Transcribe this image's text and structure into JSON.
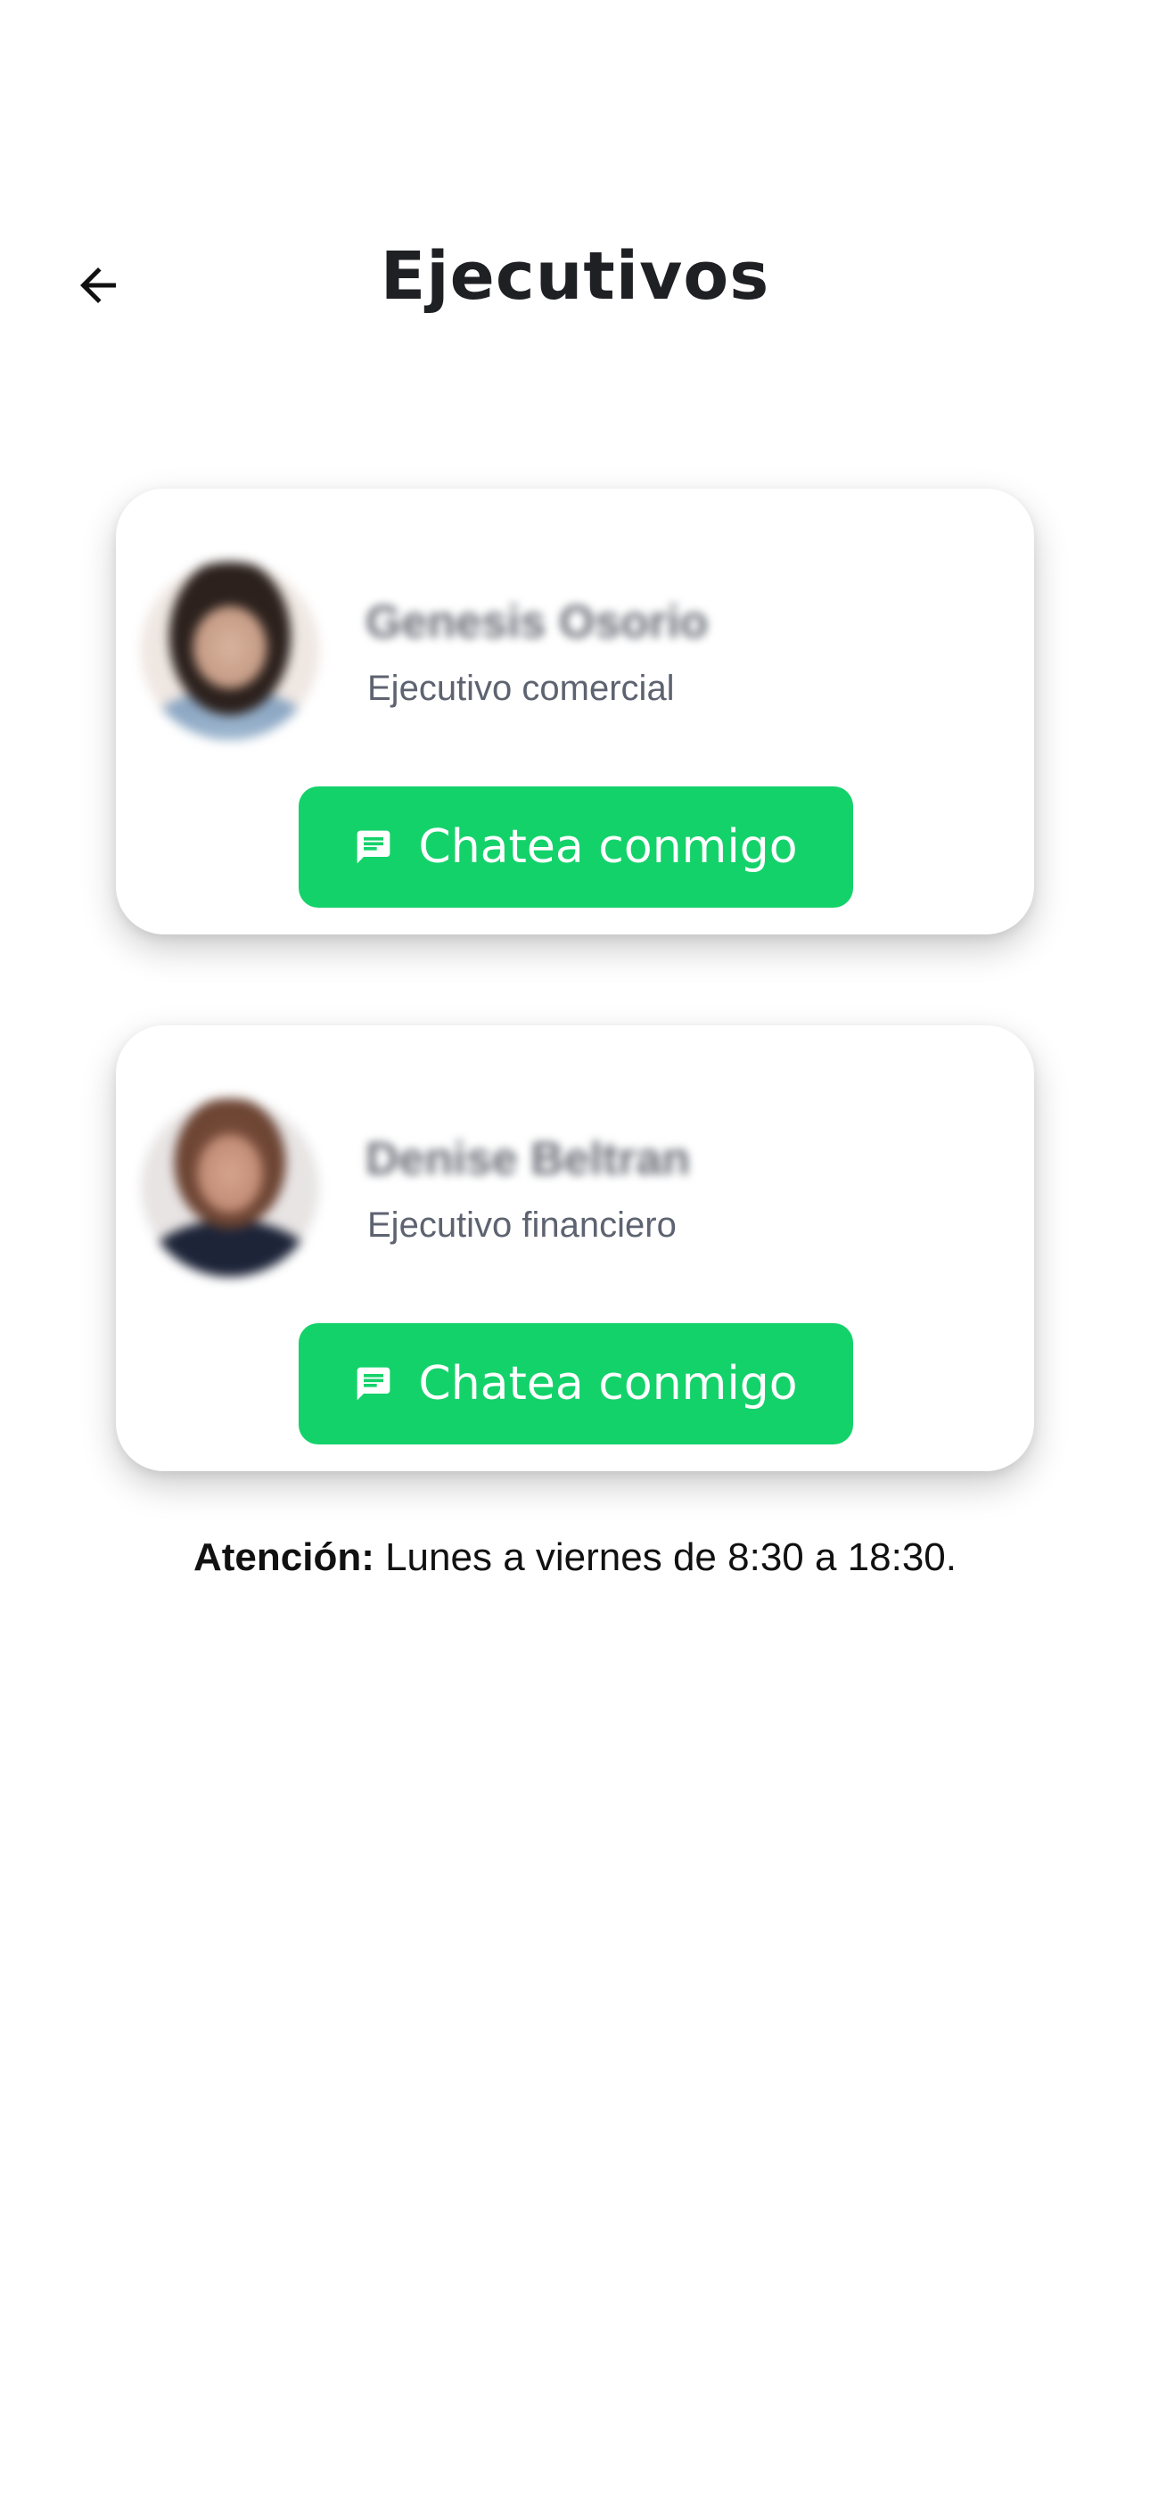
{
  "header": {
    "title": "Ejecutivos",
    "back_icon": "arrow-left-icon"
  },
  "executives": [
    {
      "name": "Genesis Osorio",
      "role": "Ejecutivo comercial",
      "button_label": "Chatea conmigo",
      "button_icon": "chat-message-icon"
    },
    {
      "name": "Denise Beltran",
      "role": "Ejecutivo financiero",
      "button_label": "Chatea conmigo",
      "button_icon": "chat-message-icon"
    }
  ],
  "attention": {
    "label": "Atención:",
    "text": " Lunes a viernes de 8:30 a 18:30."
  },
  "colors": {
    "accent_green": "#14d26a",
    "background": "#ffffff",
    "title_text": "#1f2024"
  }
}
